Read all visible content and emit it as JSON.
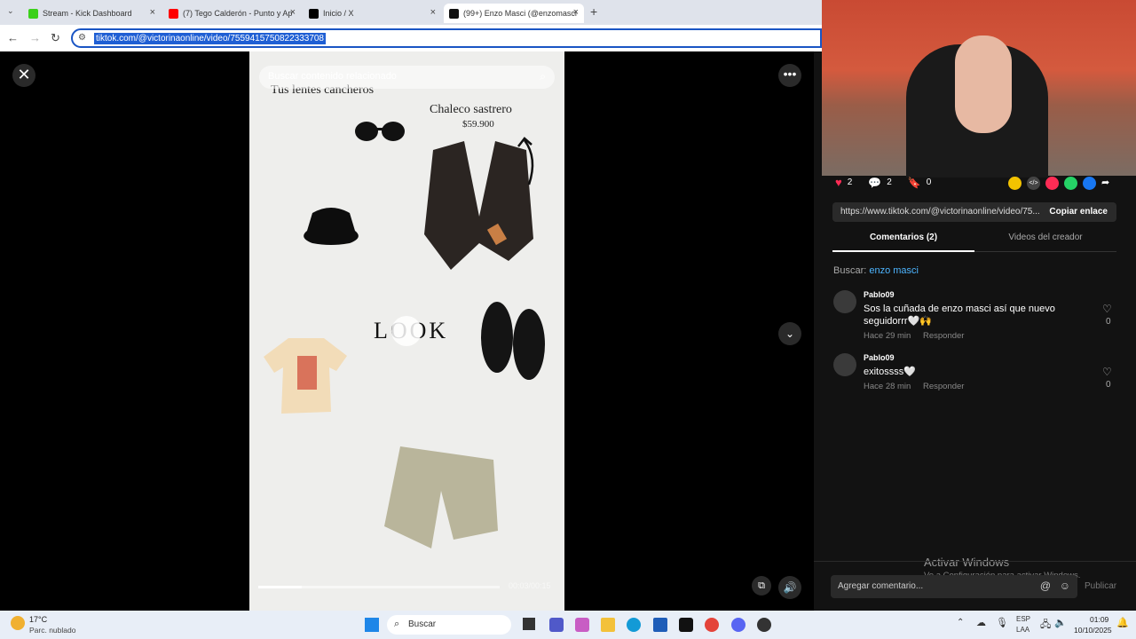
{
  "tabs": [
    {
      "title": "Stream - Kick Dashboard",
      "color": "#3bd11a"
    },
    {
      "title": "(7) Tego Calderón - Punto y Ap",
      "color": "#ff0000"
    },
    {
      "title": "Inicio / X",
      "color": "#000000"
    },
    {
      "title": "(99+) Enzo Masci (@enzomasci",
      "color": "#111111"
    }
  ],
  "address": {
    "url": "tiktok.com/@victorinaonline/video/7559415750822333708"
  },
  "video": {
    "search_placeholder": "Buscar contenido relacionado",
    "label_lentes": "Tus lentes cancheros",
    "label_chaleco": "Chaleco sastrero",
    "price_chaleco": "$59.900",
    "look_text": "LOOK"
  },
  "stats": {
    "likes": "2",
    "comments": "2",
    "saves": "0"
  },
  "link": {
    "url": "https://www.tiktok.com/@victorinaonline/video/75...",
    "copy_label": "Copiar enlace"
  },
  "tabs2": {
    "comments": "Comentarios (2)",
    "videos": "Videos del creador"
  },
  "search": {
    "prefix": "Buscar:",
    "term": "enzo masci"
  },
  "comments": [
    {
      "user": "Pablo09",
      "text": "Sos la cuñada de enzo masci así que nuevo seguidorrr🤍🙌",
      "time": "Hace 29 min",
      "reply": "Responder",
      "likes": "0"
    },
    {
      "user": "Pablo09",
      "text": "exitossss🤍",
      "time": "Hace 28 min",
      "reply": "Responder",
      "likes": "0"
    }
  ],
  "watermark": {
    "line1": "Activar Windows",
    "line2": "Ve a Configuración para activar Windows."
  },
  "comment_input": {
    "placeholder": "Agregar comentario...",
    "post": "Publicar"
  },
  "weather": {
    "temp": "17°C",
    "desc": "Parc. nublado"
  },
  "taskbar": {
    "search": "Buscar",
    "lang1": "ESP",
    "lang2": "LAA",
    "time": "01:09",
    "date": "10/10/2025"
  }
}
